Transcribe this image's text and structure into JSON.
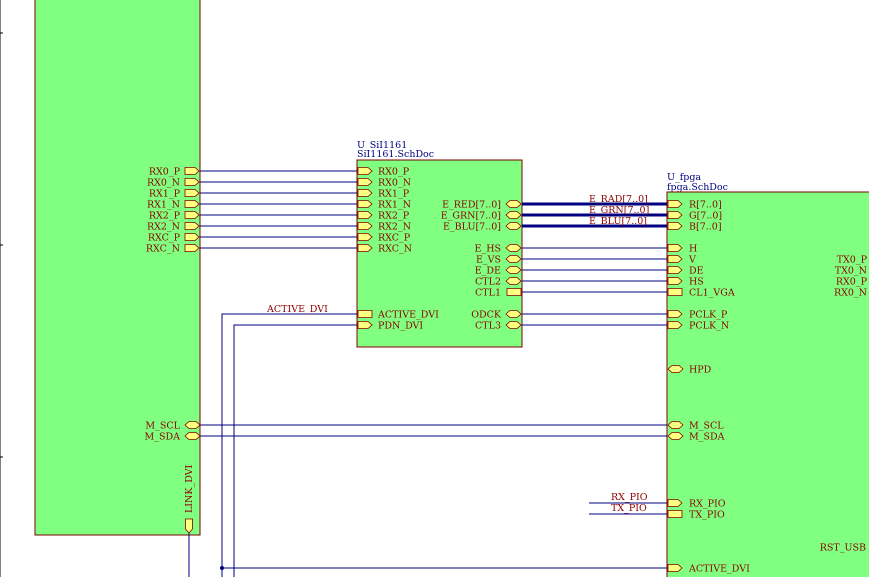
{
  "sheets": {
    "left": {
      "ports_right": [
        "RX0_P",
        "RX0_N",
        "RX1_P",
        "RX1_N",
        "RX2_P",
        "RX2_N",
        "RXC_P",
        "RXC_N"
      ],
      "ports_m": [
        "M_SCL",
        "M_SDA"
      ],
      "port_bottom": "LINK_DVI"
    },
    "sii": {
      "designator": "U_SiI1161",
      "filename": "SiI1161.SchDoc",
      "ports_left": [
        "RX0_P",
        "RX0_N",
        "RX1_P",
        "RX1_N",
        "RX2_P",
        "RX2_N",
        "RXC_P",
        "RXC_N"
      ],
      "ports_left_lower": [
        "ACTIVE_DVI",
        "PDN_DVI"
      ],
      "ports_right_bus": [
        "E_RED[7..0]",
        "E_GRN[7..0]",
        "E_BLU[7..0]"
      ],
      "ports_right_sync": [
        "E_HS",
        "E_VS",
        "E_DE",
        "CTL2",
        "CTL1"
      ],
      "ports_right_lower": [
        "ODCK",
        "CTL3"
      ]
    },
    "fpga": {
      "designator": "U_fpga",
      "filename": "fpga.SchDoc",
      "ports_bus": [
        "R[7..0]",
        "G[7..0]",
        "B[7..0]"
      ],
      "ports_sync": [
        "H",
        "V",
        "DE",
        "HS",
        "CL1_VGA"
      ],
      "ports_pclk": [
        "PCLK_P",
        "PCLK_N"
      ],
      "port_hpd": "HPD",
      "ports_m": [
        "M_SCL",
        "M_SDA"
      ],
      "ports_pio": [
        "RX_PIO",
        "TX_PIO"
      ],
      "port_active": "ACTIVE_DVI",
      "right_labels": [
        "TX0_P",
        "TX0_N",
        "RX0_P",
        "RX0_N"
      ],
      "rst_label": "RST_USB"
    }
  },
  "nets": {
    "bus_labels": [
      "E_RAD[7..0]",
      "E_GRN[7..0]",
      "E_BLU[7..0]"
    ],
    "active_dvi": "ACTIVE_DVI",
    "pio": [
      "RX_PIO",
      "TX_PIO"
    ]
  }
}
